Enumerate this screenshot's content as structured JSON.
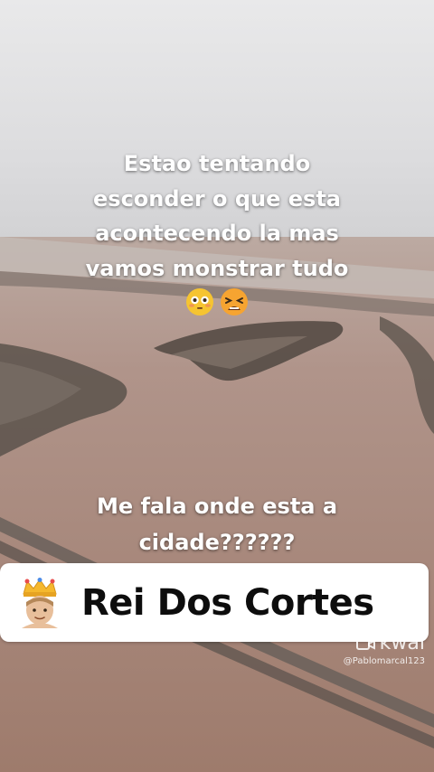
{
  "caption_top": {
    "lines": [
      "Estao tentando",
      "esconder o que esta",
      "acontecendo la mas",
      "vamos monstrar tudo"
    ],
    "emojis": [
      "flushed-face-emoji",
      "tired-face-emoji"
    ]
  },
  "caption_bottom": {
    "lines": [
      "Me fala onde esta a",
      "cidade??????"
    ]
  },
  "banner": {
    "icon": "crown-person-emoji",
    "title": "Rei Dos Cortes"
  },
  "watermark": {
    "logo": "kwai",
    "username": "@Pablomarcal123"
  },
  "colors": {
    "flood_water": "#a98474",
    "sky": "#e3e3e4",
    "banner_bg": "#ffffff",
    "banner_text": "#0d0d0d"
  }
}
